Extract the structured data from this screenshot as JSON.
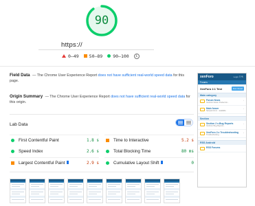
{
  "score": {
    "value": "90",
    "fraction": 0.9,
    "color": "#0cce6b"
  },
  "url": "https://",
  "legend": {
    "items": [
      {
        "label": "0–49",
        "color": "#e53935"
      },
      {
        "label": "50–89",
        "color": "#fb8c00"
      },
      {
        "label": "90–100",
        "color": "#0cce6b"
      }
    ],
    "info_icon": "info-icon"
  },
  "field_data": {
    "title": "Field Data",
    "text_before": "— The Chrome User Experience Report",
    "link": "does not have sufficient real-world speed data",
    "text_after": "for this page."
  },
  "origin_summary": {
    "title": "Origin Summary",
    "text_before": "— The Chrome User Experience Report",
    "link": "does not have sufficient real-world speed data",
    "text_after": "for this origin."
  },
  "lab_data": {
    "title": "Lab Data",
    "metrics": [
      {
        "label": "First Contentful Paint",
        "value": "1.8 s",
        "status": "green"
      },
      {
        "label": "Time to Interactive",
        "value": "5.2 s",
        "status": "orange"
      },
      {
        "label": "Speed Index",
        "value": "2.6 s",
        "status": "green"
      },
      {
        "label": "Total Blocking Time",
        "value": "80 ms",
        "status": "green"
      },
      {
        "label": "Largest Contentful Paint",
        "value": "2.9 s",
        "status": "orange"
      },
      {
        "label": "Cumulative Layout Shift",
        "value": "0",
        "status": "green"
      }
    ]
  },
  "preview": {
    "logo": "xenForo",
    "nav": "Login  ☰  🔍",
    "sub": "Forums",
    "title": "XenForo 2.1 Test",
    "post_button": "Post thread",
    "categories": [
      {
        "name": "Main category",
        "forums": [
          {
            "name": "Forum News",
            "desc": "XenForo News: Product Hi..."
          },
          {
            "name": "Main forum",
            "desc": "Sample forum · available"
          }
        ]
      },
      {
        "name": "Section",
        "forums": [
          {
            "name": "Section 2 e-Bug Reports",
            "desc": "XenForo Bug Reports..."
          },
          {
            "name": "XenForo 2.x Troubleshooting",
            "desc": "Troubleshooting..."
          }
        ]
      },
      {
        "name": "RSS Android",
        "forums": [
          {
            "name": "RSS Forums",
            "desc": ""
          }
        ]
      }
    ]
  },
  "filmstrip": {
    "frames": 9
  }
}
